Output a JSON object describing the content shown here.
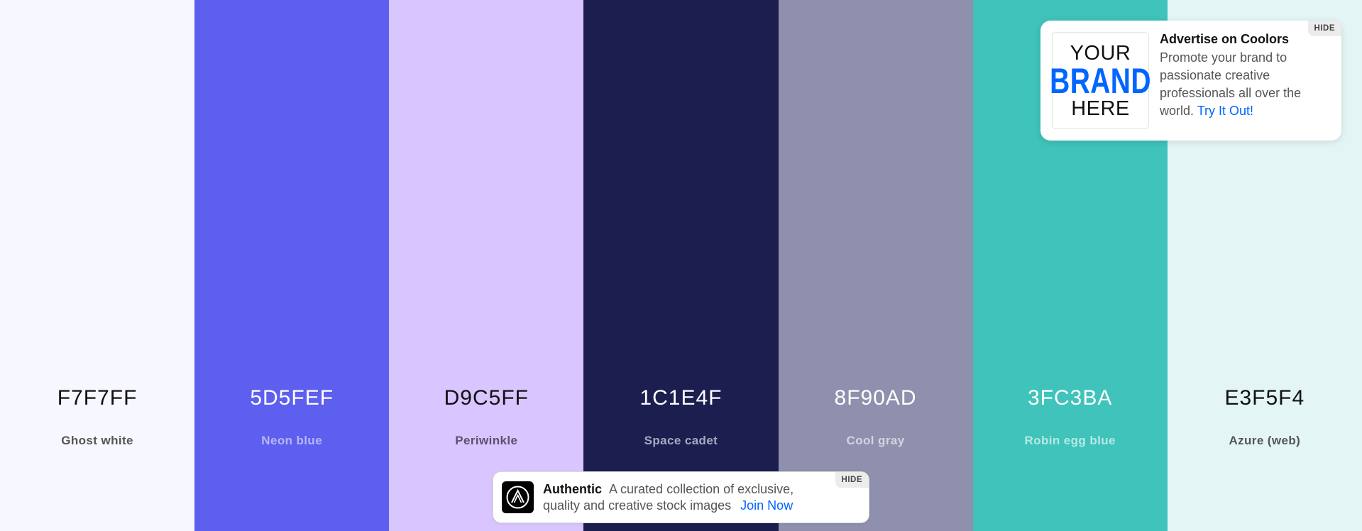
{
  "palette": {
    "colors": [
      {
        "hex": "F7F7FF",
        "name": "Ghost white",
        "bg": "#F7F7FF",
        "hex_color": "#111111",
        "name_color": "#555555"
      },
      {
        "hex": "5D5FEF",
        "name": "Neon blue",
        "bg": "#5D5FEF",
        "hex_color": "#FFFFFF",
        "name_color": "#B7B8F7"
      },
      {
        "hex": "D9C5FF",
        "name": "Periwinkle",
        "bg": "#D9C5FF",
        "hex_color": "#111111",
        "name_color": "#5A5170"
      },
      {
        "hex": "1C1E4F",
        "name": "Space cadet",
        "bg": "#1C1E4F",
        "hex_color": "#FFFFFF",
        "name_color": "#A8A9C0"
      },
      {
        "hex": "8F90AD",
        "name": "Cool gray",
        "bg": "#8F90AD",
        "hex_color": "#FFFFFF",
        "name_color": "#D3D4E0"
      },
      {
        "hex": "3FC3BA",
        "name": "Robin egg blue",
        "bg": "#3FC3BA",
        "hex_color": "#FFFFFF",
        "name_color": "#B6E9E5"
      },
      {
        "hex": "E3F5F4",
        "name": "Azure (web)",
        "bg": "#E3F5F4",
        "hex_color": "#111111",
        "name_color": "#555555"
      }
    ]
  },
  "ad_card": {
    "logo_line1": "YOUR",
    "logo_line2": "BRAND",
    "logo_line3": "HERE",
    "title": "Advertise on Coolors",
    "text": "Promote your brand to passionate creative professionals all over the world.",
    "link": "Try It Out!",
    "hide": "HIDE"
  },
  "ad_bottom": {
    "brand": "Authentic",
    "text": "A curated collection of exclusive, quality and creative stock images",
    "link": "Join Now",
    "hide": "HIDE"
  },
  "colors": {
    "link": "#0066FF"
  }
}
